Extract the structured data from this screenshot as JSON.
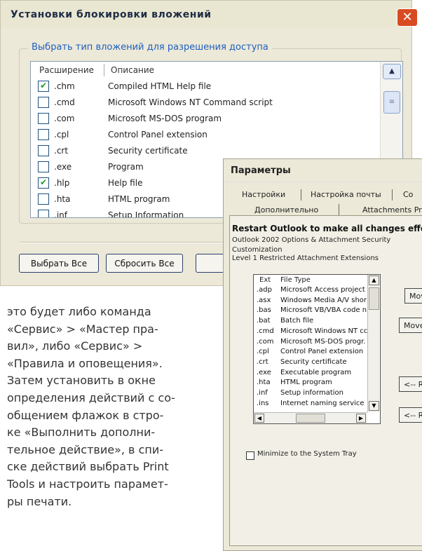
{
  "attachment_dialog": {
    "title": "Установки блокировки вложений",
    "close_icon": "close-icon",
    "group_label": "Выбрать тип вложений для разрешения доступа",
    "columns": [
      "Расширение",
      "Описание"
    ],
    "rows": [
      {
        "checked": true,
        "ext": ".chm",
        "desc": "Compiled HTML Help file"
      },
      {
        "checked": false,
        "ext": ".cmd",
        "desc": "Microsoft Windows NT Command script"
      },
      {
        "checked": false,
        "ext": ".com",
        "desc": "Microsoft MS-DOS program"
      },
      {
        "checked": false,
        "ext": ".cpl",
        "desc": "Control Panel extension"
      },
      {
        "checked": false,
        "ext": ".crt",
        "desc": "Security certificate"
      },
      {
        "checked": false,
        "ext": ".exe",
        "desc": "Program"
      },
      {
        "checked": true,
        "ext": ".hlp",
        "desc": "Help file"
      },
      {
        "checked": false,
        "ext": ".hta",
        "desc": "HTML program"
      },
      {
        "checked": false,
        "ext": ".inf",
        "desc": "Setup Information"
      }
    ],
    "select_all_label": "Выбрать Все",
    "reset_all_label": "Сбросить Все"
  },
  "params_dialog": {
    "title": "Параметры",
    "tabs_row1": [
      "Настройки",
      "Настройка почты",
      "Co"
    ],
    "tabs_row2": [
      "Дополнительно",
      "Attachments Pro"
    ],
    "heading": "Restart Outlook to make all changes effec",
    "line1": "Outlook 2002 Options & Attachment Security",
    "line2": "Customization",
    "line3": "Level 1 Restricted Attachment Extensions",
    "columns": [
      "Ext",
      "File Type"
    ],
    "rows": [
      {
        "ext": ".adp",
        "type": "Microsoft Access project"
      },
      {
        "ext": ".asx",
        "type": "Windows Media A/V shor"
      },
      {
        "ext": ".bas",
        "type": "Microsoft VB/VBA code n"
      },
      {
        "ext": ".bat",
        "type": "Batch file"
      },
      {
        "ext": ".cmd",
        "type": "Microsoft Windows NT cc"
      },
      {
        "ext": ".com",
        "type": "Microsoft MS-DOS progr."
      },
      {
        "ext": ".cpl",
        "type": "Control Panel extension"
      },
      {
        "ext": ".crt",
        "type": "Security certificate"
      },
      {
        "ext": ".exe",
        "type": "Executable program"
      },
      {
        "ext": ".hta",
        "type": "HTML program"
      },
      {
        "ext": ".inf",
        "type": "Setup information"
      },
      {
        "ext": ".ins",
        "type": "Internet naming service"
      }
    ],
    "move_btn_1": "Mov",
    "move_btn_2": "Move",
    "back_btn_1": "<-- R",
    "back_btn_2": "<-- Re",
    "minimize_label": "Minimize to the System Tray",
    "minimize_checked": false
  },
  "article_lines": [
    "это будет либо команда",
    "«Сервис» > «Мастер пра-",
    "вил», либо «Сервис» >",
    "«Правила и оповещения».",
    "Затем установить в окне",
    "определения действий с со-",
    "общением флажок в стро-",
    "ке «Выполнить дополни-",
    "тельное действие», в спи-",
    "ске действий выбрать Print",
    "Tools и настроить парамет-",
    "ры печати."
  ]
}
